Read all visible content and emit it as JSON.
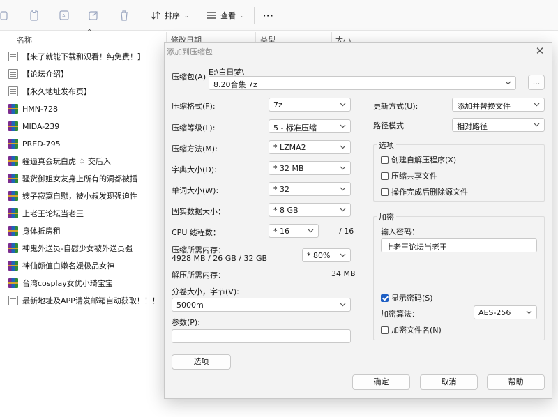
{
  "toolbar": {
    "sort_label": "排序",
    "view_label": "查看",
    "more_label": "···"
  },
  "columns": {
    "name": "名称",
    "modified": "修改日期",
    "type": "类型",
    "size": "大小"
  },
  "files": [
    {
      "name": "【来了就能下载和观看！纯免费！】",
      "icon": "text-file-icon"
    },
    {
      "name": "【论坛介绍】",
      "icon": "text-file-icon"
    },
    {
      "name": "【永久地址发布页】",
      "icon": "text-file-icon"
    },
    {
      "name": "HMN-728",
      "icon": "archive-icon"
    },
    {
      "name": "MIDA-239",
      "icon": "archive-icon"
    },
    {
      "name": "PRED-795",
      "icon": "archive-icon"
    },
    {
      "name": "骚逼真会玩白虎 ♤ 交后入",
      "icon": "archive-icon"
    },
    {
      "name": "骚货御姐女友身上所有的洞都被插",
      "icon": "archive-icon"
    },
    {
      "name": "嫂子寂寞自慰，被小叔发现强迫性",
      "icon": "archive-icon"
    },
    {
      "name": "上老王论坛当老王",
      "icon": "archive-icon"
    },
    {
      "name": "身体抵房租",
      "icon": "archive-icon"
    },
    {
      "name": "神鬼外送员-自慰少女被外送员强",
      "icon": "archive-icon"
    },
    {
      "name": "神仙颜值白嫩名媛极品女神",
      "icon": "archive-icon"
    },
    {
      "name": "台湾cosplay女优小琦宝宝",
      "icon": "archive-icon"
    },
    {
      "name": "最新地址及APP请发邮箱自动获取！！！",
      "icon": "text-file-icon"
    }
  ],
  "dialog": {
    "title": "添加到压缩包",
    "close": "✕",
    "archive_label": "压缩包(A)",
    "archive_dir": "E:\\白日梦\\",
    "archive_name": "8.20合集 7z",
    "browse_label": "...",
    "format_label": "压缩格式(F):",
    "format_value": "7z",
    "level_label": "压缩等级(L):",
    "level_value": "5 - 标准压缩",
    "method_label": "压缩方法(M):",
    "method_value": "* LZMA2",
    "dict_label": "字典大小(D):",
    "dict_value": "* 32 MB",
    "word_label": "单词大小(W):",
    "word_value": "* 32",
    "solid_label": "固实数据大小：",
    "solid_value": "* 8 GB",
    "threads_label": "CPU 线程数：",
    "threads_value": "* 16",
    "threads_total": "/ 16",
    "mem_comp_label": "压缩所需内存：",
    "mem_comp_value": "4928 MB / 26 GB / 32 GB",
    "mem_percent": "* 80%",
    "mem_decomp_label": "解压所需内存：",
    "mem_decomp_value": "34 MB",
    "split_label": "分卷大小，字节(V):",
    "split_value": "5000m",
    "params_label": "参数(P):",
    "params_value": "",
    "options_button": "选项",
    "update_label": "更新方式(U):",
    "update_value": "添加并替换文件",
    "path_label": "路径模式",
    "path_value": "相对路径",
    "options_group": "选项",
    "opt_sfx": "创建自解压程序(X)",
    "opt_shared": "压缩共享文件",
    "opt_delete": "操作完成后删除源文件",
    "encrypt_group": "加密",
    "password_label": "输入密码：",
    "password_value": "上老王论坛当老王",
    "show_password": "显示密码(S)",
    "enc_method_label": "加密算法：",
    "enc_method_value": "AES-256",
    "encrypt_names": "加密文件名(N)",
    "ok": "确定",
    "cancel": "取消",
    "help": "帮助"
  }
}
